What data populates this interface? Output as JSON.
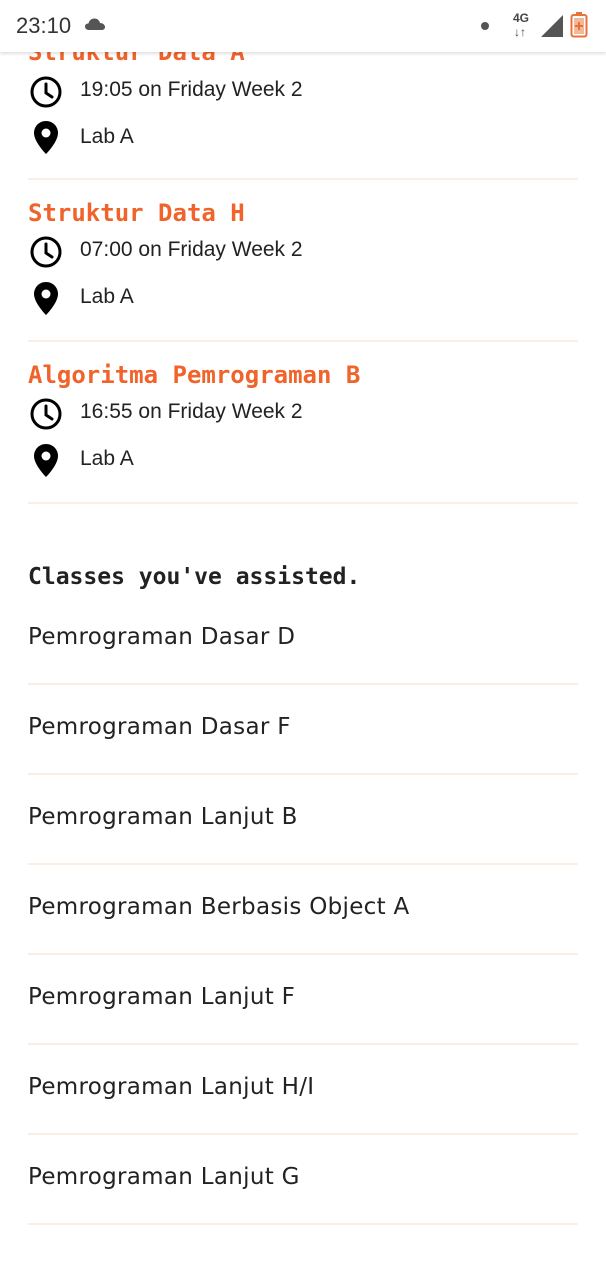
{
  "status_bar": {
    "time": "23:10",
    "network": "4G",
    "network_arrows": "↓↑"
  },
  "schedule": [
    {
      "title": "Struktur Data A",
      "time": "19:05 on Friday Week 2",
      "location": "Lab A"
    },
    {
      "title": "Struktur Data H",
      "time": "07:00 on Friday Week 2",
      "location": "Lab A"
    },
    {
      "title": "Algoritma Pemrograman B",
      "time": "16:55 on Friday Week 2",
      "location": "Lab A"
    }
  ],
  "assisted": {
    "heading": "Classes you've assisted.",
    "items": [
      "Pemrograman Dasar D",
      "Pemrograman Dasar F",
      "Pemrograman Lanjut B",
      "Pemrograman Berbasis Object A",
      "Pemrograman Lanjut F",
      "Pemrograman Lanjut H/I",
      "Pemrograman Lanjut G"
    ]
  },
  "colors": {
    "accent": "#f0642c",
    "divider": "#fbeee4",
    "text": "#222222"
  },
  "icons": {
    "time": "clock-icon",
    "location": "map-pin-icon"
  }
}
